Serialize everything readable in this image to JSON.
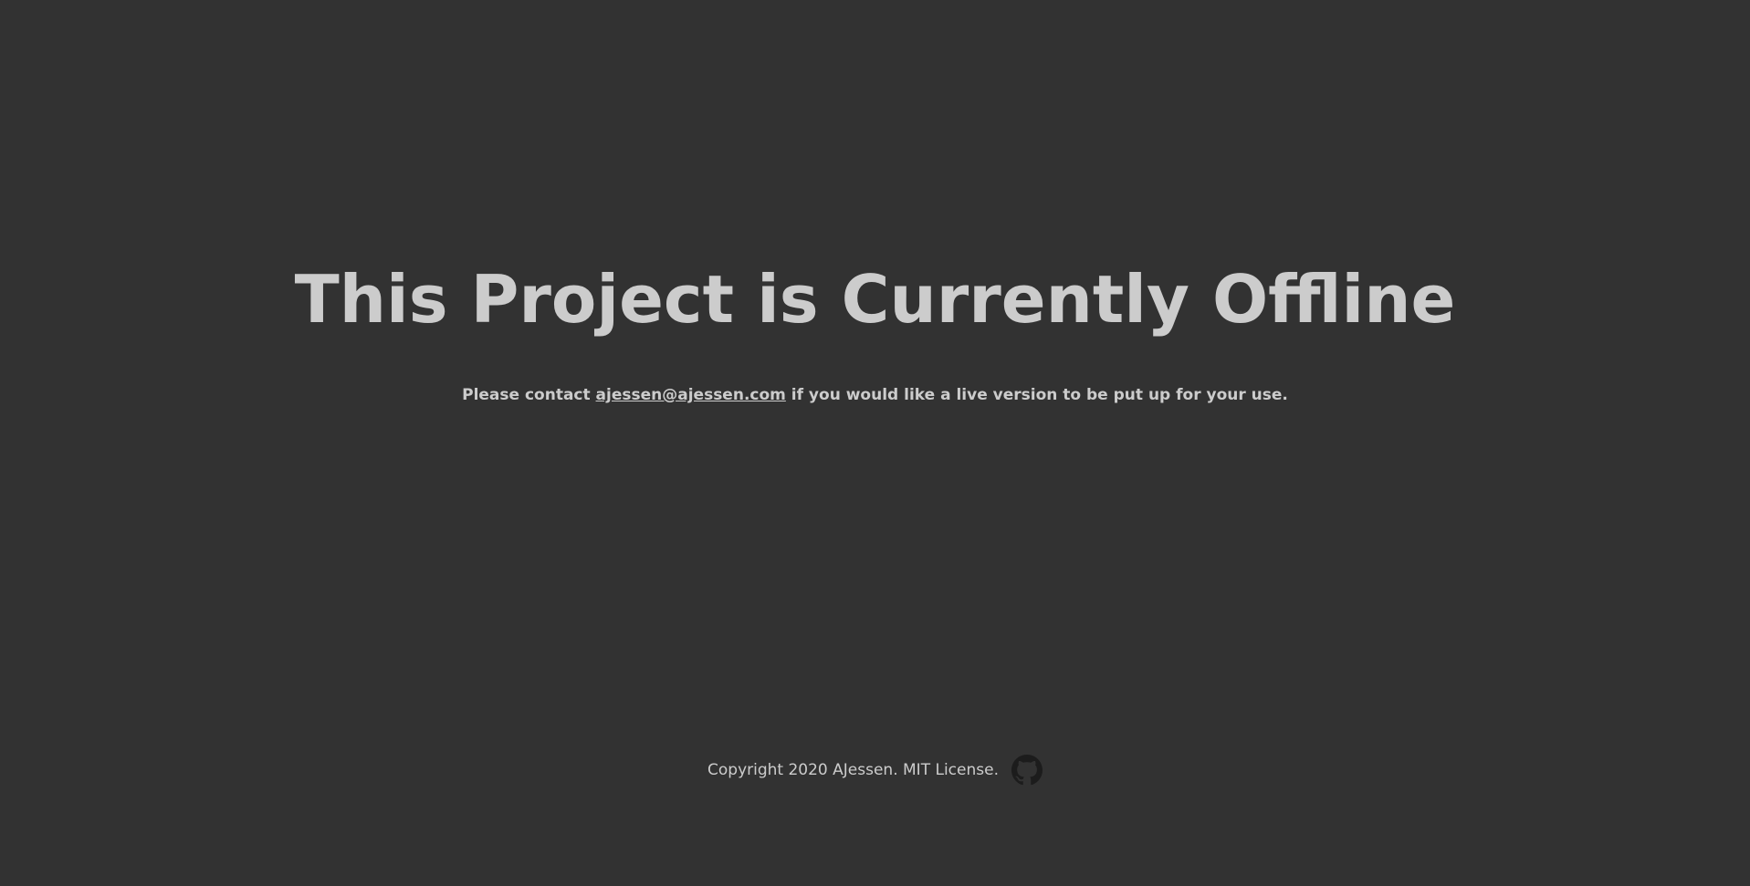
{
  "page": {
    "heading": "This Project is Currently Offline",
    "contact": {
      "before": "Please contact ",
      "email": "ajessen@ajessen.com",
      "after": " if you would like a live version to be put up for your use."
    },
    "footer": {
      "copyright": "Copyright 2020 AJessen. MIT License.",
      "icon": "github-icon"
    }
  },
  "colors": {
    "background": "#323232",
    "text": "#cccccc",
    "icon": "#1c1c1c"
  }
}
